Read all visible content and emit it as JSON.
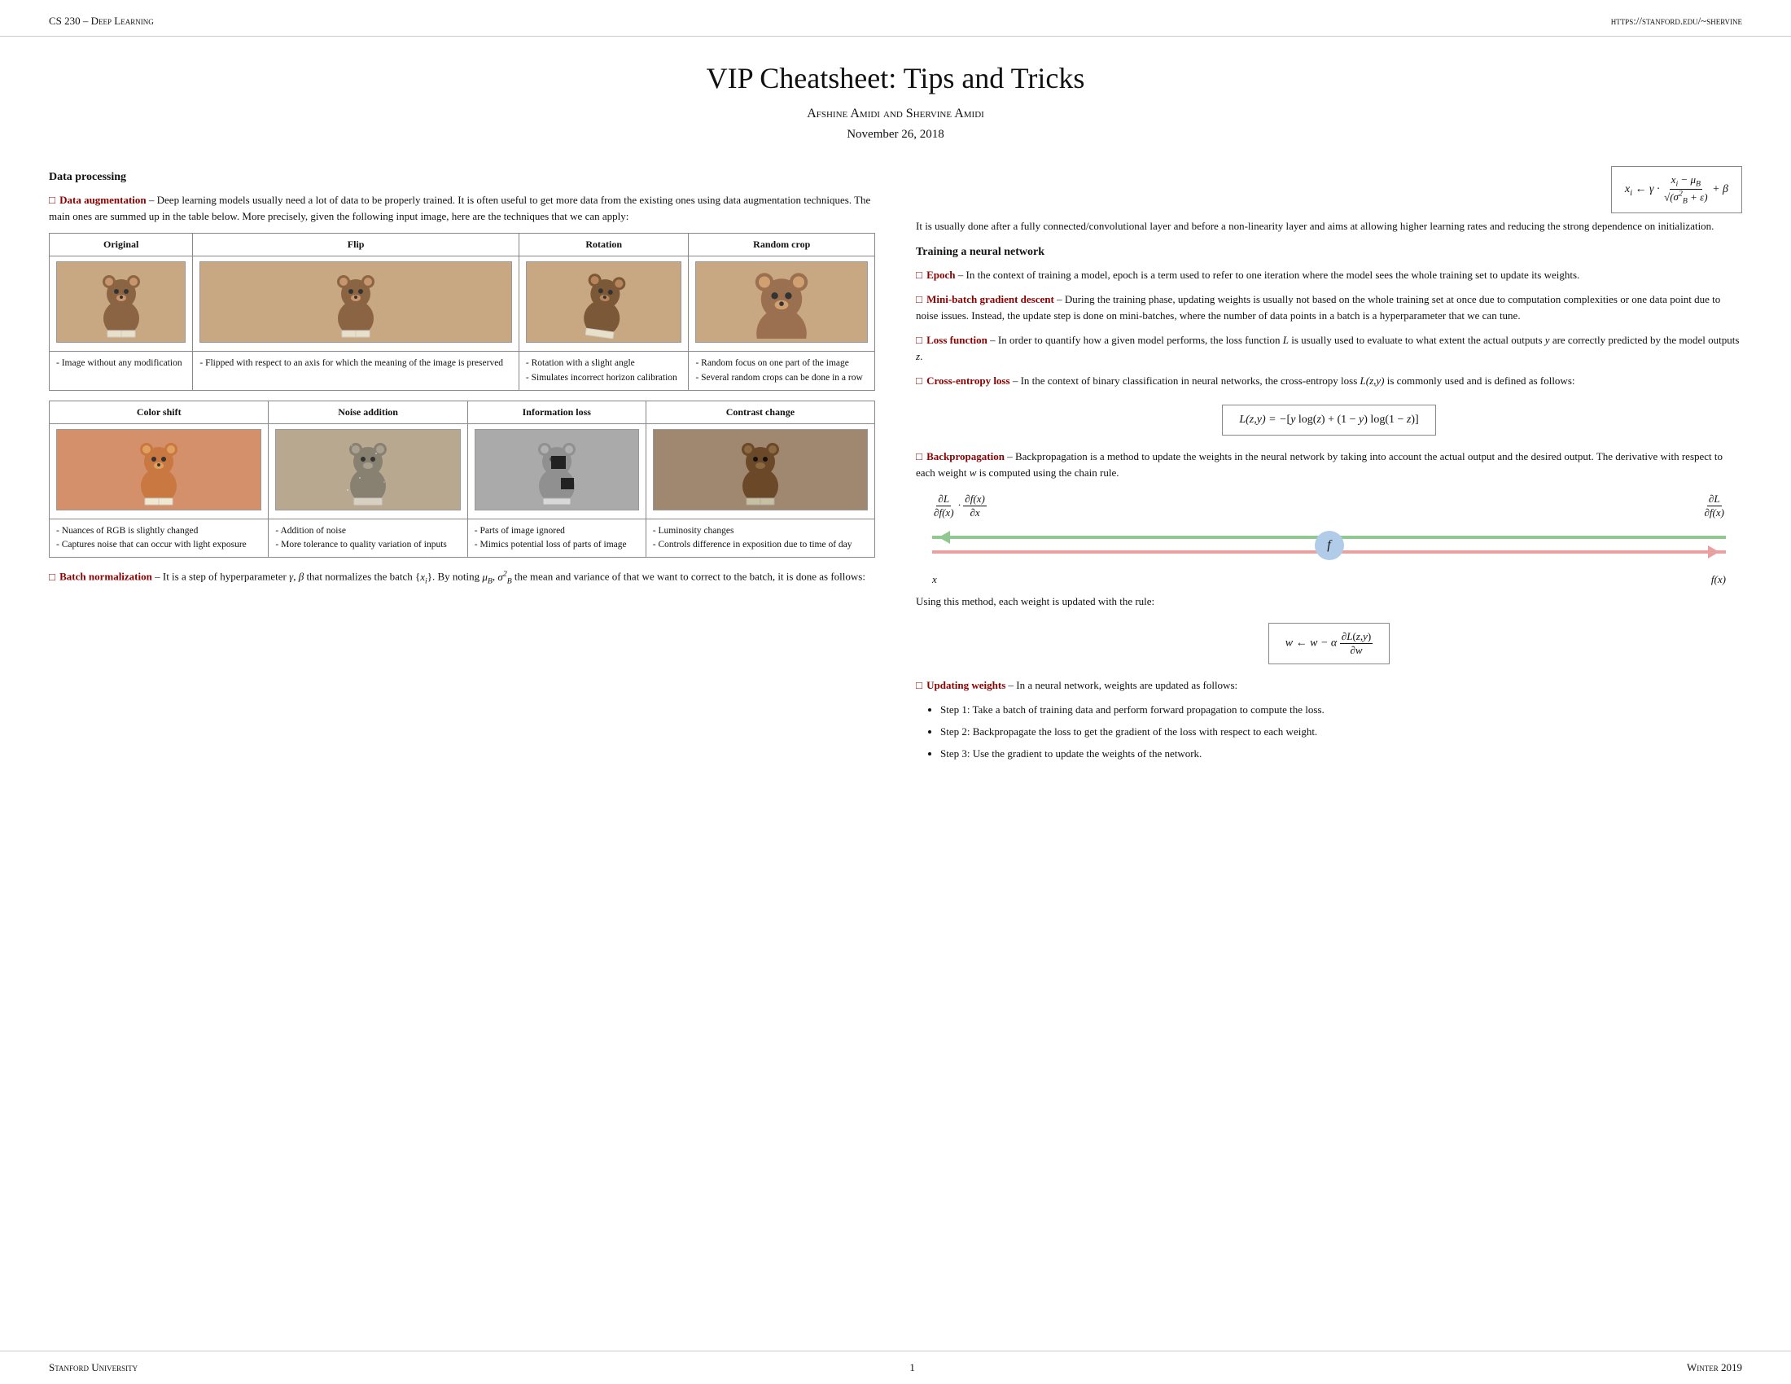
{
  "header": {
    "left": "CS 230 – Deep Learning",
    "right": "https://stanford.edu/~shervine"
  },
  "footer": {
    "left": "Stanford University",
    "center": "1",
    "right": "Winter 2019"
  },
  "title": "VIP Cheatsheet: Tips and Tricks",
  "authors": "Afshine Amidi and Shervine Amidi",
  "date": "November 26, 2018",
  "left_col": {
    "section": "Data processing",
    "data_augmentation_term": "Data augmentation",
    "data_augmentation_desc": "– Deep learning models usually need a lot of data to be properly trained. It is often useful to get more data from the existing ones using data augmentation techniques. The main ones are summed up in the table below. More precisely, given the following input image, here are the techniques that we can apply:",
    "table1": {
      "headers": [
        "Original",
        "Flip",
        "Rotation",
        "Random crop"
      ],
      "desc_row": [
        "- Image without any modification",
        "- Flipped with respect to an axis for which the meaning of the image is preserved",
        "- Rotation with a slight angle\n- Simulates incorrect horizon calibration",
        "- Random focus on one part of the image\n- Several random crops can be done in a row"
      ]
    },
    "table2": {
      "headers": [
        "Color shift",
        "Noise addition",
        "Information loss",
        "Contrast change"
      ],
      "desc_row": [
        "- Nuances of RGB is slightly changed\n- Captures noise that can occur with light exposure",
        "- Addition of noise\n- More tolerance to quality variation of inputs",
        "- Parts of image ignored\n- Mimics potential loss of parts of image",
        "- Luminosity changes\n- Controls difference in exposition due to time of day"
      ]
    },
    "batch_norm_term": "Batch normalization",
    "batch_norm_desc": "– It is a step of hyperparameter γ, β that normalizes the batch {xᵢ}. By noting μ_B, σ²_B the mean and variance of that we want to correct to the batch, it is done as follows:"
  },
  "right_col": {
    "bn_formula_desc": "It is usually done after a fully connected/convolutional layer and before a non-linearity layer and aims at allowing higher learning rates and reducing the strong dependence on initialization.",
    "section": "Training a neural network",
    "epoch_term": "Epoch",
    "epoch_desc": "– In the context of training a model, epoch is a term used to refer to one iteration where the model sees the whole training set to update its weights.",
    "minibatch_term": "Mini-batch gradient descent",
    "minibatch_desc": "– During the training phase, updating weights is usually not based on the whole training set at once due to computation complexities or one data point due to noise issues. Instead, the update step is done on mini-batches, where the number of data points in a batch is a hyperparameter that we can tune.",
    "loss_term": "Loss function",
    "loss_desc": "– In order to quantify how a given model performs, the loss function L is usually used to evaluate to what extent the actual outputs y are correctly predicted by the model outputs z.",
    "cross_entropy_term": "Cross-entropy loss",
    "cross_entropy_desc": "– In the context of binary classification in neural networks, the cross-entropy loss L(z,y) is commonly used and is defined as follows:",
    "cross_entropy_formula": "L(z,y) = −[y log(z) + (1 − y) log(1 − z)]",
    "backprop_term": "Backpropagation",
    "backprop_desc": "– Backpropagation is a method to update the weights in the neural network by taking into account the actual output and the desired output. The derivative with respect to each weight w is computed using the chain rule.",
    "backprop_formula_left": "∂L/∂f(x)",
    "backprop_formula_mid": "∂f(x)/∂x",
    "backprop_formula_right": "∂L/∂f(x)",
    "backprop_node": "f",
    "backprop_xlabel": "x",
    "backprop_fxlabel": "f(x)",
    "backprop_update_rule": "Using this method, each weight is updated with the rule:",
    "weight_update_formula": "w ← w − α ∂L(z,y)/∂w",
    "updating_weights_term": "Updating weights",
    "updating_weights_desc": "– In a neural network, weights are updated as follows:",
    "steps": [
      "Step 1: Take a batch of training data and perform forward propagation to compute the loss.",
      "Step 2: Backpropagate the loss to get the gradient of the loss with respect to each weight.",
      "Step 3: Use the gradient to update the weights of the network."
    ]
  }
}
